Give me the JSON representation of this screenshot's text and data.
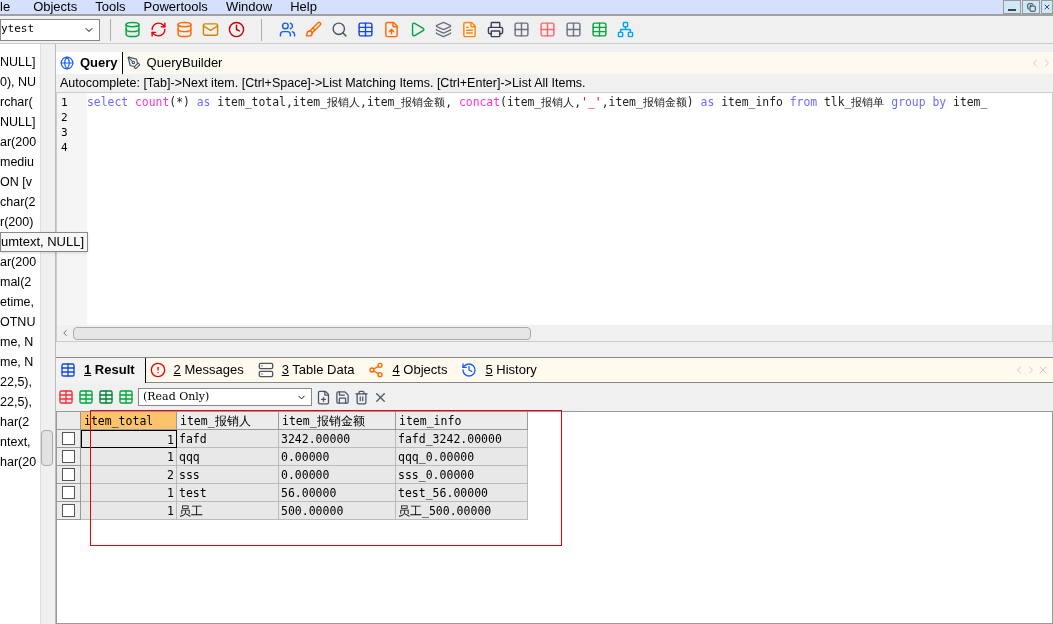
{
  "menu": [
    "le",
    "Objects",
    "Tools",
    "Powertools",
    "Window",
    "Help"
  ],
  "connection": {
    "value": "ytest"
  },
  "side_list": [
    "NULL]",
    "0), NU",
    "rchar(",
    "NULL]",
    "ar(200",
    "mediu",
    "ON [v",
    "char(2",
    "r(200)",
    "ar(200",
    "mal(2",
    "etime,",
    "OTNU",
    "me, N",
    "me, N",
    "22,5),",
    "22,5),",
    "har(2",
    "ntext,",
    "har(20"
  ],
  "tooltip": "umtext, NULL]",
  "editor_tabs": [
    {
      "label": "Query",
      "selected": true
    },
    {
      "label": "QueryBuilder",
      "selected": false
    }
  ],
  "autocomplete_hint": "Autocomplete: [Tab]->Next item. [Ctrl+Space]->List Matching Items. [Ctrl+Enter]->List All Items.",
  "editor": {
    "line_numbers": [
      "1",
      "2",
      "3",
      "4"
    ],
    "tokens": [
      {
        "text": "select ",
        "kind": "keyword"
      },
      {
        "text": "count",
        "kind": "function"
      },
      {
        "text": "(*) ",
        "kind": "plain"
      },
      {
        "text": "as ",
        "kind": "keyword"
      },
      {
        "text": "item_total,item_报销人,item_报销金额, ",
        "kind": "plain"
      },
      {
        "text": "concat",
        "kind": "function"
      },
      {
        "text": "(item_报销人,",
        "kind": "plain"
      },
      {
        "text": "'_'",
        "kind": "string"
      },
      {
        "text": ",item_报销金额) ",
        "kind": "plain"
      },
      {
        "text": "as ",
        "kind": "keyword"
      },
      {
        "text": "item_info ",
        "kind": "plain"
      },
      {
        "text": "from ",
        "kind": "keyword"
      },
      {
        "text": "tlk_报销单 ",
        "kind": "plain"
      },
      {
        "text": "group by ",
        "kind": "keyword"
      },
      {
        "text": "item_",
        "kind": "plain"
      }
    ]
  },
  "result_tabs": [
    {
      "number": "1",
      "label": "Result",
      "selected": true
    },
    {
      "number": "2",
      "label": "Messages",
      "selected": false
    },
    {
      "number": "3",
      "label": "Table Data",
      "selected": false
    },
    {
      "number": "4",
      "label": "Objects",
      "selected": false
    },
    {
      "number": "5",
      "label": "History",
      "selected": false
    }
  ],
  "result_mode": {
    "value": "(Read Only)"
  },
  "grid": {
    "columns": [
      {
        "label": "item_total",
        "selected": true
      },
      {
        "label": "item_报销人",
        "selected": false
      },
      {
        "label": "item_报销金额",
        "selected": false
      },
      {
        "label": "item_info",
        "selected": false
      }
    ],
    "rows": [
      {
        "checked": false,
        "cells": [
          "1",
          "fafd",
          "3242.00000",
          "fafd_3242.00000"
        ]
      },
      {
        "checked": false,
        "cells": [
          "1",
          "qqq",
          "0.00000",
          "qqq_0.00000"
        ]
      },
      {
        "checked": false,
        "cells": [
          "2",
          "sss",
          "0.00000",
          "sss_0.00000"
        ]
      },
      {
        "checked": false,
        "cells": [
          "1",
          "test",
          "56.00000",
          "test_56.00000"
        ]
      },
      {
        "checked": false,
        "cells": [
          "1",
          "员工",
          "500.00000",
          "员工_500.00000"
        ]
      }
    ]
  }
}
